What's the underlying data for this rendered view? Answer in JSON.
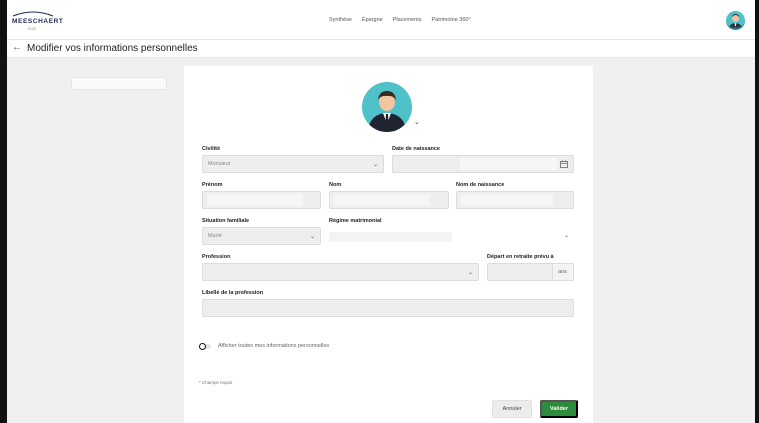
{
  "brand": {
    "name": "MEESCHAERT",
    "year": "1935"
  },
  "nav": [
    "Synthèse",
    "Épargne",
    "Placements",
    "Patrimoine 360°"
  ],
  "page": {
    "back_arrow": "←",
    "title": "Modifier vos informations personnelles"
  },
  "form": {
    "profile_chevron": "⌄",
    "civilite": {
      "label": "Civilité",
      "value": "Monsieur"
    },
    "date_naissance": {
      "label": "Date de naissance"
    },
    "prenom": {
      "label": "Prénom"
    },
    "nom": {
      "label": "Nom"
    },
    "nom_naissance": {
      "label": "Nom de naissance"
    },
    "situation": {
      "label": "Situation familiale",
      "value": "Marié"
    },
    "regime": {
      "label": "Régime matrimonial"
    },
    "profession": {
      "label": "Profession"
    },
    "retraite": {
      "label": "Départ en retraite prévu à",
      "unit": "ans"
    },
    "libelle": {
      "label": "Libellé de la profession"
    },
    "toggle_label": "Afficher toutes mes informations personnelles",
    "required_note": "* Champs requis",
    "cancel": "Annuler",
    "submit": "Valider"
  },
  "colors": {
    "accent": "#2e8b3b",
    "avatar_bg": "#4fc1c9",
    "brand_navy": "#1e2c50",
    "brand_gold": "#b89146"
  }
}
